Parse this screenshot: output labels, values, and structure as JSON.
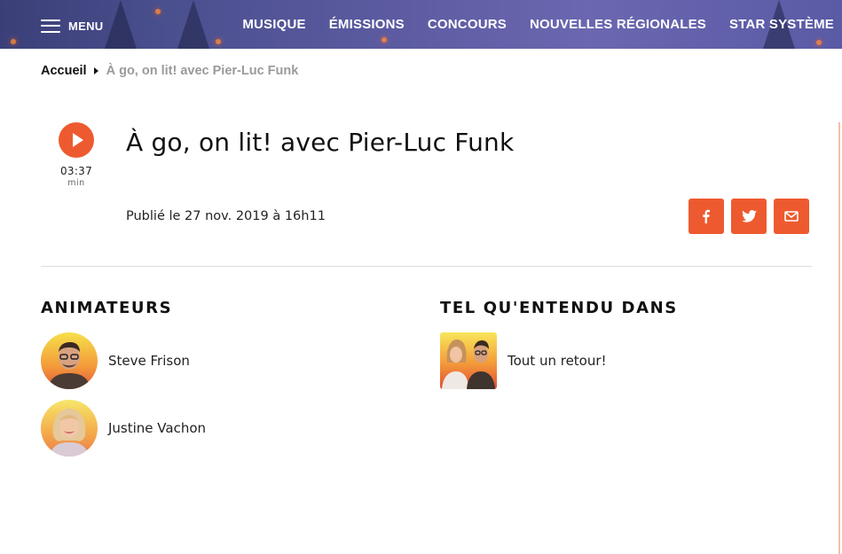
{
  "header": {
    "menu_label": "MENU",
    "nav": [
      "MUSIQUE",
      "ÉMISSIONS",
      "CONCOURS",
      "NOUVELLES RÉGIONALES",
      "STAR SYSTÈME"
    ]
  },
  "breadcrumb": {
    "home": "Accueil",
    "current": "À go, on lit! avec Pier-Luc Funk"
  },
  "player": {
    "duration": "03:37",
    "unit": "min"
  },
  "article": {
    "title": "À go, on lit! avec Pier-Luc Funk",
    "published": "Publié le 27 nov. 2019 à 16h11"
  },
  "share": {
    "icons": [
      "facebook-icon",
      "twitter-icon",
      "email-icon"
    ]
  },
  "hosts": {
    "heading": "ANIMATEURS",
    "items": [
      {
        "name": "Steve Frison"
      },
      {
        "name": "Justine Vachon"
      }
    ]
  },
  "heard_in": {
    "heading": "TEL QU'ENTENDU DANS",
    "items": [
      {
        "name": "Tout un retour!"
      }
    ]
  },
  "colors": {
    "accent": "#ee5a2f",
    "nav_bg": "#4a4f8e"
  }
}
